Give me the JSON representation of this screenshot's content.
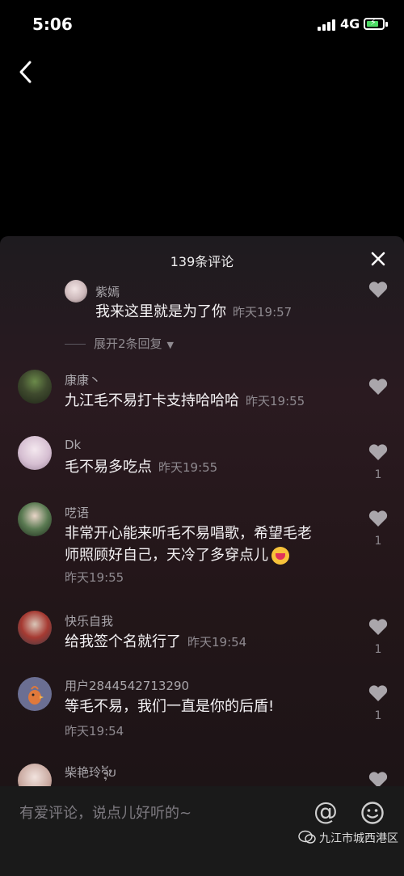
{
  "status": {
    "time": "5:06",
    "network": "4G"
  },
  "header": {
    "title": "139条评论"
  },
  "comments": [
    {
      "user": "紫嫣",
      "text": "我来这里就是为了你",
      "time": "昨天19:57",
      "likes": ""
    },
    {
      "user": "康康丶",
      "text": "九江毛不易打卡支持哈哈哈",
      "time": "昨天19:55",
      "likes": ""
    },
    {
      "user": "Dk",
      "text": "毛不易多吃点",
      "time": "昨天19:55",
      "likes": "1"
    },
    {
      "user": "呓语",
      "text_line1": "非常开心能来听毛不易唱歌，希望毛老",
      "text_line2": "师照顾好自己，天冷了多穿点儿",
      "time": "昨天19:55",
      "likes": "1"
    },
    {
      "user": "快乐自我",
      "text": "给我签个名就行了",
      "time": "昨天19:54",
      "likes": "1"
    },
    {
      "user": "用户2844542713290",
      "text": "等毛不易，我们一直是你的后盾!",
      "time": "昨天19:54",
      "likes": "1"
    },
    {
      "user": "柴艳玲ຈຸ້ບ"
    }
  ],
  "replies": {
    "expand_label": "展开2条回复"
  },
  "input": {
    "placeholder": "有爱评论，说点儿好听的~",
    "at_symbol": "@"
  },
  "watermark": {
    "text": "九江市城西港区"
  },
  "colors": {
    "panel": "#231619",
    "text": "#f4f2f4",
    "muted": "#8f8a90",
    "battery": "#4cd964"
  },
  "icons": [
    "back-arrow-icon",
    "close-icon",
    "heart-icon",
    "emoji-icon",
    "wechat-icon"
  ]
}
